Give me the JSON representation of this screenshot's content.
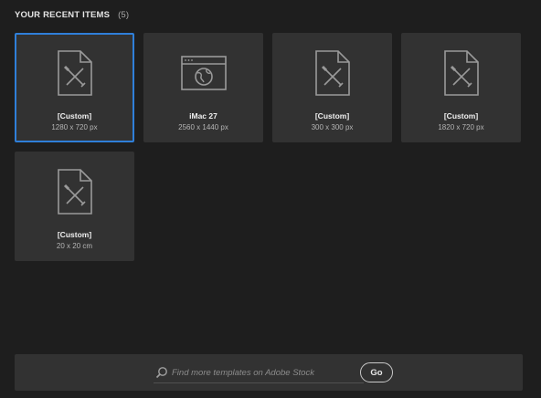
{
  "recent": {
    "title": "YOUR RECENT ITEMS",
    "count": "(5)",
    "items": [
      {
        "name": "[Custom]",
        "dims": "1280 x 720 px",
        "icon": "custom-document-icon",
        "selected": true
      },
      {
        "name": "iMac 27",
        "dims": "2560 x 1440 px",
        "icon": "web-browser-icon",
        "selected": false
      },
      {
        "name": "[Custom]",
        "dims": "300 x 300 px",
        "icon": "custom-document-icon",
        "selected": false
      },
      {
        "name": "[Custom]",
        "dims": "1820 x 720 px",
        "icon": "custom-document-icon",
        "selected": false
      },
      {
        "name": "[Custom]",
        "dims": "20 x 20 cm",
        "icon": "custom-document-icon",
        "selected": false
      }
    ]
  },
  "search": {
    "placeholder": "Find more templates on Adobe Stock",
    "go_label": "Go"
  },
  "colors": {
    "background": "#1e1e1e",
    "card": "#323232",
    "selection": "#2f7fd9"
  }
}
